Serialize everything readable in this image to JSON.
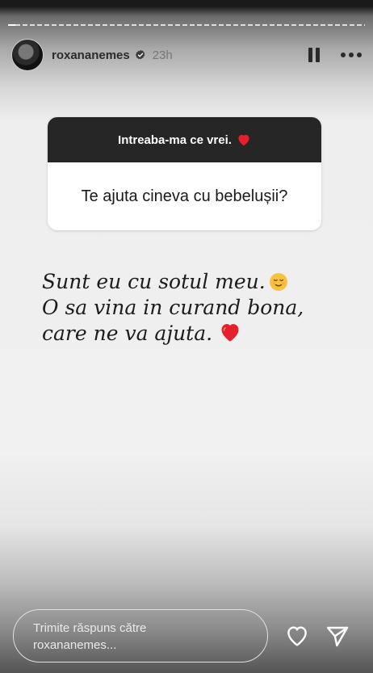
{
  "header": {
    "username": "roxananemes",
    "time": "23h",
    "progress_fraction": 0.02
  },
  "question": {
    "prompt": "Intreaba-ma ce vrei.",
    "text": "Te ajuta cineva cu bebelușii?"
  },
  "answer": {
    "line1": "Sunt eu cu sotul meu.",
    "line2": "O sa vina in curand bona,",
    "line3": "care ne va ajuta."
  },
  "reply": {
    "line1": "Trimite răspuns către",
    "line2": "roxananemes..."
  },
  "icons": {
    "verified": "verified-badge-icon",
    "pause": "pause-icon",
    "more": "more-options-icon",
    "heart": "heart-icon",
    "send": "send-icon"
  },
  "colors": {
    "heart": "#e5202a",
    "question_header": "#262626"
  }
}
